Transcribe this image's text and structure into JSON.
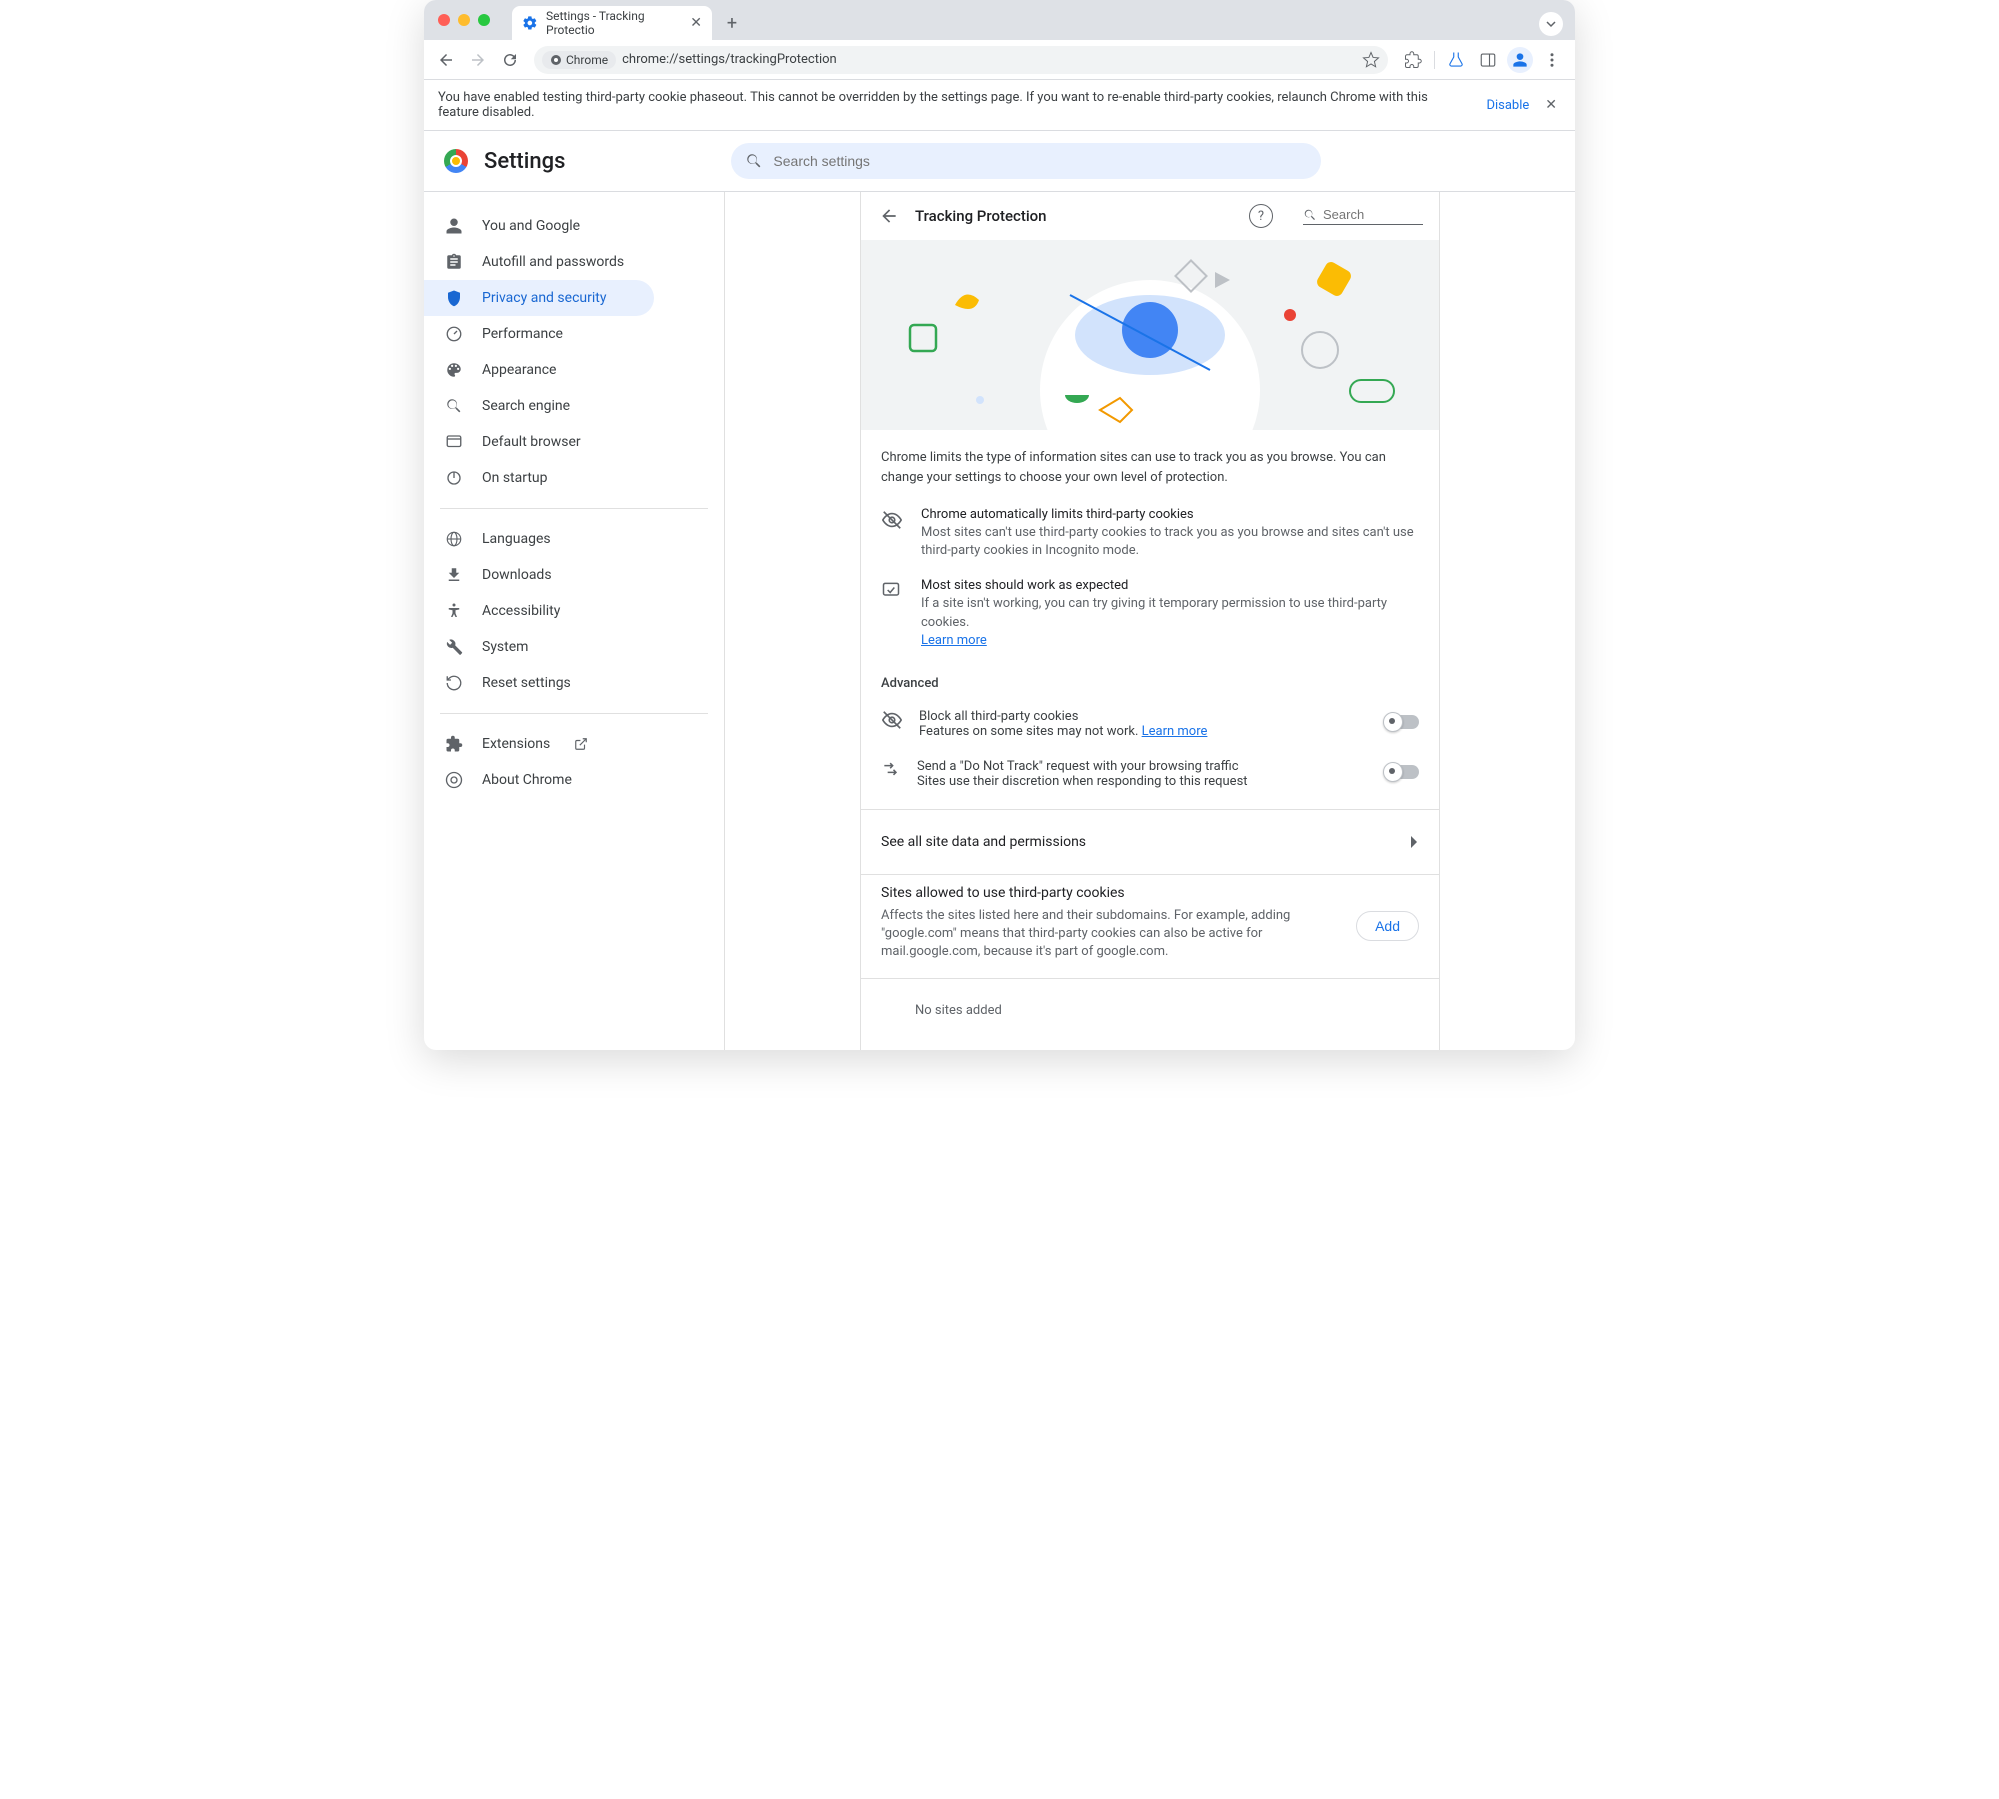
{
  "window": {
    "tab_title": "Settings - Tracking Protectio",
    "omnibox_chip": "Chrome",
    "url": "chrome://settings/trackingProtection"
  },
  "infobar": {
    "text": "You have enabled testing third-party cookie phaseout. This cannot be overridden by the settings page. If you want to re-enable third-party cookies, relaunch Chrome with this feature disabled.",
    "link": "Disable"
  },
  "header": {
    "title": "Settings",
    "search_placeholder": "Search settings"
  },
  "sidebar": {
    "items": [
      {
        "label": "You and Google"
      },
      {
        "label": "Autofill and passwords"
      },
      {
        "label": "Privacy and security"
      },
      {
        "label": "Performance"
      },
      {
        "label": "Appearance"
      },
      {
        "label": "Search engine"
      },
      {
        "label": "Default browser"
      },
      {
        "label": "On startup"
      }
    ],
    "group2": [
      {
        "label": "Languages"
      },
      {
        "label": "Downloads"
      },
      {
        "label": "Accessibility"
      },
      {
        "label": "System"
      },
      {
        "label": "Reset settings"
      }
    ],
    "group3": [
      {
        "label": "Extensions"
      },
      {
        "label": "About Chrome"
      }
    ]
  },
  "panel": {
    "title": "Tracking Protection",
    "search_placeholder": "Search",
    "intro": "Chrome limits the type of information sites can use to track you as you browse. You can change your settings to choose your own level of protection.",
    "row1": {
      "title": "Chrome automatically limits third-party cookies",
      "desc": "Most sites can't use third-party cookies to track you as you browse and sites can't use third-party cookies in Incognito mode."
    },
    "row2": {
      "title": "Most sites should work as expected",
      "desc": "If a site isn't working, you can try giving it temporary permission to use third-party cookies.",
      "link": "Learn more"
    },
    "advanced_label": "Advanced",
    "toggle1": {
      "title": "Block all third-party cookies",
      "desc": "Features on some sites may not work.",
      "link": "Learn more"
    },
    "toggle2": {
      "title": "Send a \"Do Not Track\" request with your browsing traffic",
      "desc": "Sites use their discretion when responding to this request"
    },
    "nav_row": "See all site data and permissions",
    "allow": {
      "title": "Sites allowed to use third-party cookies",
      "desc": "Affects the sites listed here and their subdomains. For example, adding \"google.com\" means that third-party cookies can also be active for mail.google.com, because it's part of google.com.",
      "add": "Add",
      "empty": "No sites added"
    }
  }
}
